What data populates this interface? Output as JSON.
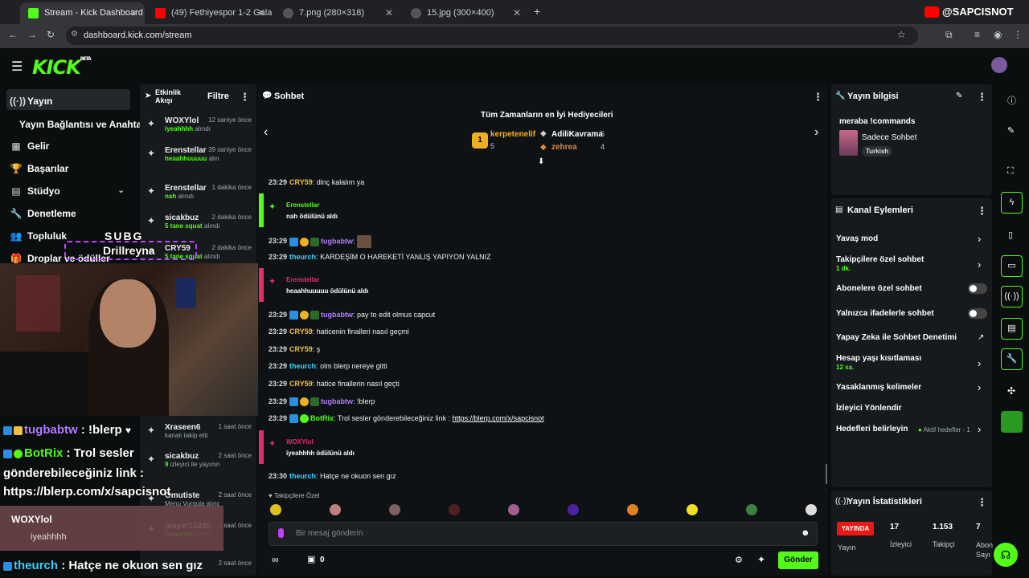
{
  "browser": {
    "tabs": [
      {
        "title": "Stream - Kick Dashboard",
        "active": true
      },
      {
        "title": "(49) Fethiyespor 1-2 Galatasaray",
        "active": false
      },
      {
        "title": "7.png (280×318)",
        "active": false
      },
      {
        "title": "15.jpg (300×400)",
        "active": false
      }
    ],
    "url": "dashboard.kick.com/stream",
    "yt_badge": "@SAPCISNOT"
  },
  "app": {
    "logo": "KICK",
    "logo_sup": "BETA"
  },
  "nav": {
    "items": [
      {
        "label": "Yayın",
        "icon": "stream-icon"
      },
      {
        "label": "Yayın Bağlantısı ve Anahtarı",
        "icon": ""
      },
      {
        "label": "Gelir",
        "icon": "chart-icon"
      },
      {
        "label": "Başarılar",
        "icon": "trophy-icon"
      },
      {
        "label": "Stüdyo",
        "icon": "studio-icon"
      },
      {
        "label": "Denetleme",
        "icon": "wrench-icon"
      },
      {
        "label": "Topluluk",
        "icon": "people-icon"
      },
      {
        "label": "Droplar ve ödüller",
        "icon": "gift-icon"
      }
    ]
  },
  "activity": {
    "title": "Etkinlik Akışı",
    "filter": "Filtre",
    "items": [
      {
        "user": "WOXYlol",
        "time": "12 saniye önce",
        "sub": "iyeahhhh",
        "action": "alındı"
      },
      {
        "user": "Erenstellar",
        "time": "39 saniye önce",
        "sub": "heaahhuuuuu",
        "action": "alındı"
      },
      {
        "user": "Erenstellar",
        "time": "1 dakika önce",
        "sub": "nah",
        "action": "alındı"
      },
      {
        "user": "sicakbuz",
        "time": "2 dakika önce",
        "sub": "5 tane squat",
        "action": "alındı"
      },
      {
        "user": "CRY59",
        "time": "2 dakika önce",
        "sub": "5 tane squat",
        "action": "alındı"
      },
      {
        "user": "Xraseen6",
        "time": "1 saat önce",
        "sub": "",
        "action": "kanalı takip etti"
      },
      {
        "user": "sicakbuz",
        "time": "2 saat önce",
        "sub": "9",
        "action": "izleyici ile yayınınıza katıldı"
      },
      {
        "user": "Omutiste",
        "time": "2 saat önce",
        "sub": "",
        "action": "Menu Vurgula alındı"
      },
      {
        "user": "player15245324",
        "time": "2 saat önce",
        "sub": "iyeahhhh",
        "action": "alındı"
      },
      {
        "user": "",
        "time": "2 saat önce",
        "sub": "",
        "action": ""
      }
    ]
  },
  "chat": {
    "title": "Sohbet",
    "gifters_title": "Tüm Zamanların en İyi Hediyecileri",
    "gifters": [
      {
        "name": "kerpetenelif",
        "count": "5",
        "rank": "1"
      },
      {
        "name": "AdiliKavrama",
        "count": "5"
      },
      {
        "name": "zehrea",
        "count": "4"
      }
    ],
    "messages": [
      {
        "time": "23:29",
        "user": "CRY59",
        "text": "dinç kalalım ya",
        "color": "#f0c040"
      },
      {
        "redeem_user": "Erenstellar",
        "redeem_text": "nah ödülünü aldı"
      },
      {
        "time": "23:29",
        "user": "tugbabtw",
        "text": "",
        "color": "#b57cff"
      },
      {
        "time": "23:29",
        "user": "theurch",
        "text": "KARDEŞİM O HAREKETİ YANLIŞ YAPIYON YALNIZ",
        "color": "#3fd0ff"
      },
      {
        "redeem_user": "Erenstellar",
        "redeem_text": "heaahhuuuuu ödülünü aldı"
      },
      {
        "time": "23:29",
        "user": "tugbabtw",
        "text": "pay to edit olmus capcut",
        "color": "#b57cff"
      },
      {
        "time": "23:29",
        "user": "CRY59",
        "text": "haticenin finalleri nasıl geçmi",
        "color": "#f0c040"
      },
      {
        "time": "23:29",
        "user": "CRY59",
        "text": "ş",
        "color": "#f0c040"
      },
      {
        "time": "23:29",
        "user": "theurch",
        "text": "olm blerp nereye gitti",
        "color": "#3fd0ff"
      },
      {
        "time": "23:29",
        "user": "CRY59",
        "text": "hatice finallerin nasıl geçti",
        "color": "#f0c040"
      },
      {
        "time": "23:29",
        "user": "tugbabtw",
        "text": "!blerp",
        "color": "#b57cff"
      },
      {
        "time": "23:29",
        "user": "BotRix",
        "text": "Trol sesler gönderebileceğiniz link : ",
        "link": "https://blerp.com/x/sapcisnot",
        "color": "#53fc18"
      },
      {
        "redeem_user": "WOXYlol",
        "redeem_text": "iyeahhhh ödülünü aldı"
      },
      {
        "time": "23:30",
        "user": "theurch",
        "text": "Hatçe ne okuon sen gız",
        "color": "#3fd0ff"
      }
    ],
    "emote_row_label": "Takipçilere Özel",
    "input_placeholder": "Bir mesaj gönderin",
    "points": "0",
    "send": "Gönder"
  },
  "stream_info": {
    "title": "Yayın bilgisi",
    "stream_title": "meraba !commands",
    "category": "Sadece Sohbet",
    "language": "Turkish"
  },
  "channel_actions": {
    "title": "Kanal Eylemleri",
    "items": [
      {
        "label": "Yavaş mod",
        "type": "chevron"
      },
      {
        "label": "Takipçilere özel sohbet",
        "sub": "1 dk.",
        "type": "chevron"
      },
      {
        "label": "Abonelere özel sohbet",
        "type": "toggle"
      },
      {
        "label": "Yalnızca ifadelerle sohbet",
        "type": "toggle"
      },
      {
        "label": "Yapay Zeka ile Sohbet Denetimi",
        "type": "external"
      },
      {
        "label": "Hesap yaşı kısıtlaması",
        "sub": "12 sa.",
        "type": "chevron"
      },
      {
        "label": "Yasaklanmış kelimeler",
        "type": "chevron"
      },
      {
        "label": "İzleyici Yönlendir",
        "type": "none"
      },
      {
        "label": "Hedefleri belirleyin",
        "sub": "Aktif hedefler - 1",
        "type": "chevron"
      }
    ]
  },
  "stats": {
    "title": "Yayın İstatistikleri",
    "live": "YAYINDA",
    "live_label": "Yayın",
    "viewers": "17",
    "viewers_label": "İzleyici",
    "followers": "1.153",
    "followers_label": "Takipçi",
    "subs": "7",
    "subs_label": "Abon Sayı"
  },
  "overlay": {
    "lines": [
      {
        "user": "tugbabtw",
        "text": ": !blerp"
      },
      {
        "user": "BotRix",
        "text": ": Trol sesler"
      },
      {
        "user": "",
        "text": "gönderebileceğiniz link :"
      },
      {
        "user": "",
        "text": "https://blerp.com/x/sapcisnot"
      },
      {
        "user": "WOXYlol",
        "text": "iyeahhhh"
      },
      {
        "user": "theurch",
        "text": ": Hatçe ne okuon sen gız"
      }
    ],
    "cam_name": "Drillreyna",
    "cam_tag": "SUBG"
  },
  "colors": {
    "accent": "#53fc18",
    "bg": "#0b0e0f",
    "panel": "#171a1c",
    "live": "#e91916"
  }
}
